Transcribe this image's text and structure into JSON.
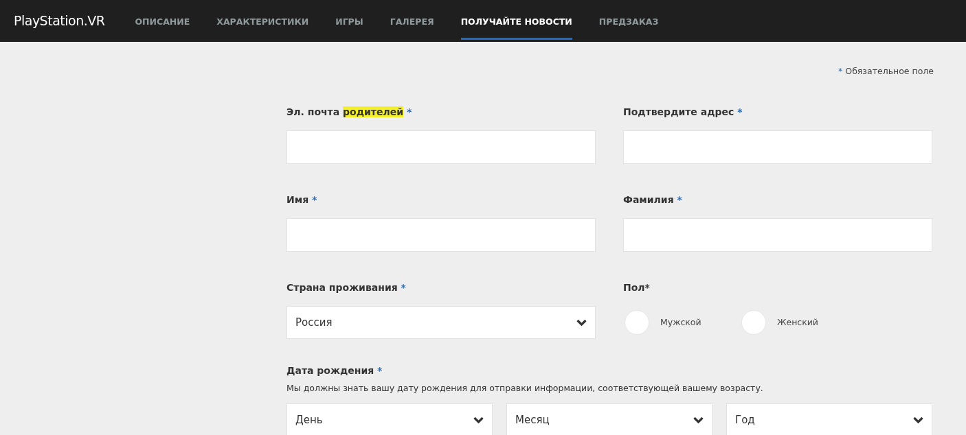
{
  "header": {
    "logo": "PlayStation.VR",
    "nav": [
      {
        "label": "ОПИСАНИЕ",
        "selected": false
      },
      {
        "label": "ХАРАКТЕРИСТИКИ",
        "selected": false
      },
      {
        "label": "ИГРЫ",
        "selected": false
      },
      {
        "label": "ГАЛЕРЕЯ",
        "selected": false
      },
      {
        "label": "ПОЛУЧАЙТЕ НОВОСТИ",
        "selected": true
      },
      {
        "label": "ПРЕДЗАКАЗ",
        "selected": false
      }
    ]
  },
  "required_note": {
    "mark": "*",
    "text": "Обязательное поле"
  },
  "fields": [
    {
      "kind": "text",
      "label": "Эл. почта",
      "highlight": "родителей",
      "mark": "*"
    },
    {
      "kind": "text",
      "label": "Подтвердите адрес",
      "mark": "*"
    },
    {
      "kind": "text",
      "label": "Имя",
      "mark": "*"
    },
    {
      "kind": "text",
      "label": "Фамилия",
      "mark": "*"
    },
    {
      "kind": "select",
      "label": "Страна проживания",
      "mark": "*",
      "value": "Россия"
    },
    {
      "kind": "radio",
      "label": "Пол*",
      "options": [
        {
          "label": "Мужской",
          "selected": false
        },
        {
          "label": "Женский",
          "selected": false
        }
      ]
    }
  ],
  "birth_date": {
    "label": "Дата рождения",
    "mark": "*",
    "hint": "Мы должны знать вашу дату рождения для отправки информации, соответствующей вашему возрасту.",
    "selects": [
      "День",
      "Месяц",
      "Год"
    ]
  }
}
